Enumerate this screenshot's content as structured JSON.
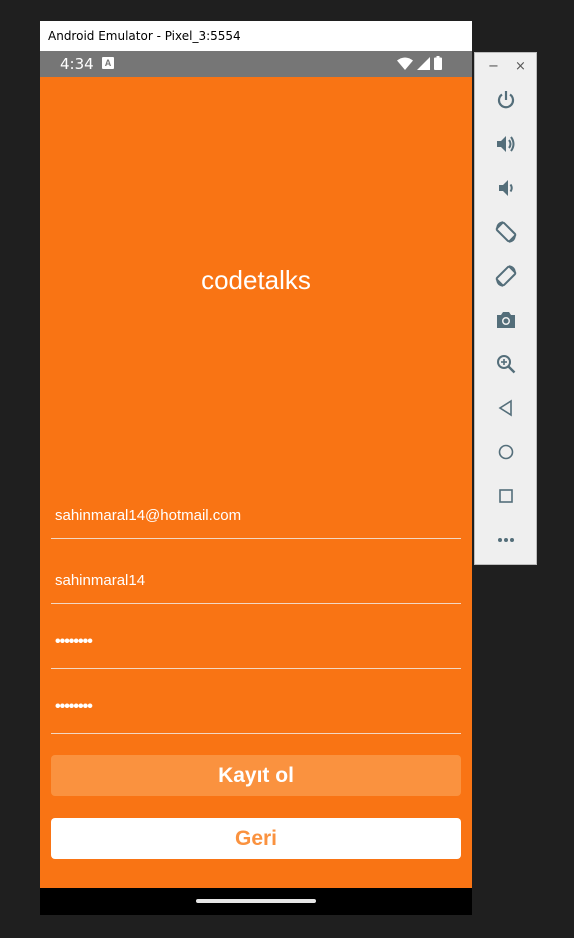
{
  "window": {
    "title": "Android Emulator - Pixel_3:5554"
  },
  "status_bar": {
    "time": "4:34",
    "notification_icon": "a-icon",
    "icons": [
      "wifi-icon",
      "signal-icon",
      "battery-icon"
    ]
  },
  "app": {
    "title": "codetalks",
    "fields": {
      "email": "sahinmaral14@hotmail.com",
      "username": "sahinmaral14",
      "password": "••••••••",
      "password_confirm": "••••••••"
    },
    "buttons": {
      "register": "Kayıt ol",
      "back": "Geri"
    },
    "colors": {
      "background": "#f97414",
      "primary_button": "#fa923f",
      "secondary_button": "#ffffff"
    }
  },
  "emulator_toolbar": {
    "minimize": "−",
    "close": "×",
    "buttons": [
      "power-icon",
      "volume-up-icon",
      "volume-down-icon",
      "rotate-left-icon",
      "rotate-right-icon",
      "camera-icon",
      "zoom-icon",
      "back-icon",
      "home-icon",
      "overview-icon",
      "more-icon"
    ]
  }
}
